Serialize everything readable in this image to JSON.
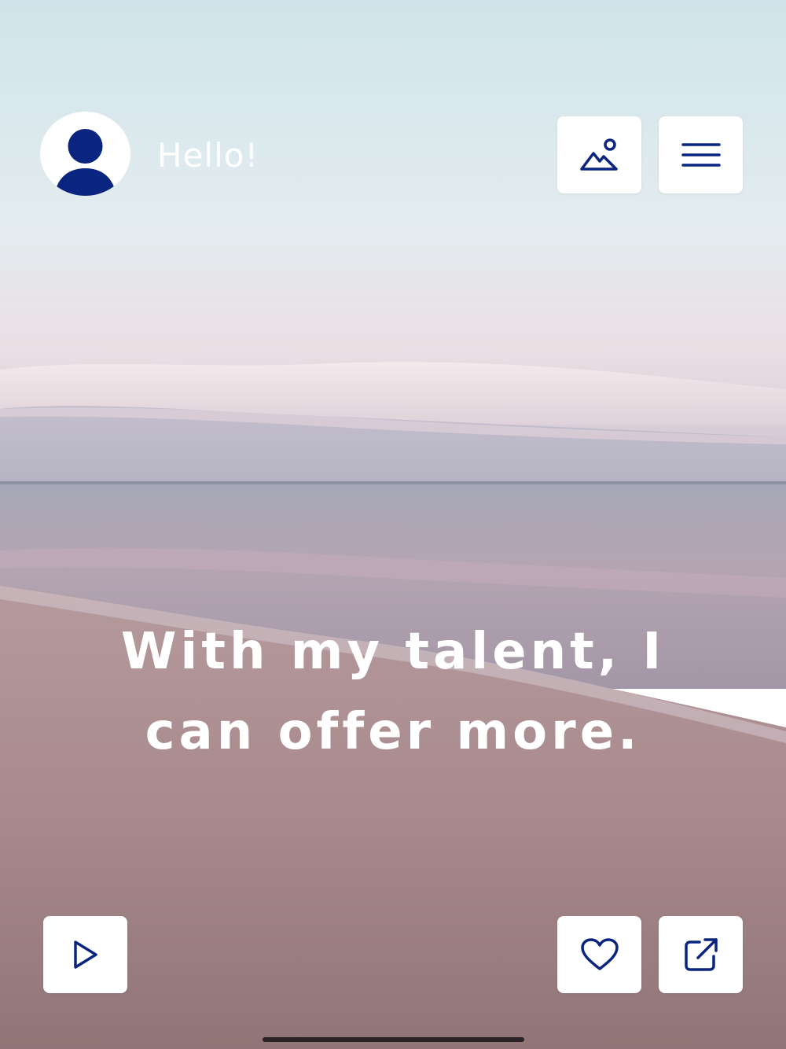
{
  "header": {
    "greeting": "Hello!",
    "avatar_icon": "user-avatar-icon",
    "scenery_button_icon": "mountain-sun-icon",
    "menu_button_icon": "hamburger-menu-icon"
  },
  "hero": {
    "tagline_line1": "With my talent, I",
    "tagline_line2": "can offer more."
  },
  "footer": {
    "play_button_icon": "play-icon",
    "like_button_icon": "heart-icon",
    "share_button_icon": "external-link-icon"
  },
  "colors": {
    "accent": "#0a2580",
    "button_bg": "#ffffff",
    "text": "#ffffff"
  }
}
